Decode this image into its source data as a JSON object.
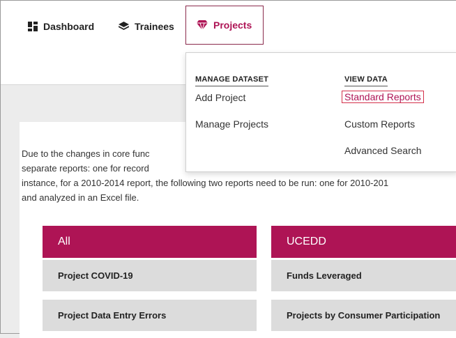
{
  "nav": {
    "dashboard": "Dashboard",
    "trainees": "Trainees",
    "projects": "Projects"
  },
  "dropdown": {
    "manage": {
      "heading": "MANAGE DATASET",
      "items": [
        "Add Project",
        "Manage Projects"
      ]
    },
    "view": {
      "heading": "VIEW DATA",
      "items": [
        "Standard Reports",
        "Custom Reports",
        "Advanced Search"
      ]
    }
  },
  "intro": {
    "line1": "Due to the changes in core func",
    "line2": "separate reports: one for record",
    "line3": "instance, for a 2010-2014 report, the following two reports need to be run: one for 2010-201",
    "line4": "and analyzed in an Excel file."
  },
  "panels": {
    "all": {
      "title": "All",
      "rows": [
        "Project COVID-19",
        "Project Data Entry Errors"
      ]
    },
    "ucedd": {
      "title": "UCEDD",
      "rows": [
        "Funds Leveraged",
        "Projects by Consumer Participation"
      ]
    }
  },
  "colors": {
    "accent": "#ae1455",
    "highlight": "#d4304a"
  }
}
